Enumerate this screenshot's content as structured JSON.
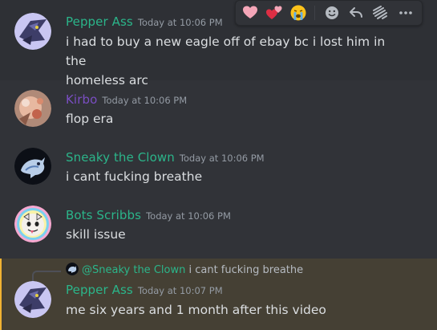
{
  "messages": [
    {
      "username": "Pepper Ass",
      "username_color": "#2bb58a",
      "timestamp": "Today at 10:06 PM",
      "content_line1": "i had to buy a new eagle off of ebay bc i lost him in the",
      "content_line2": "homeless arc"
    },
    {
      "username": "Kirbo",
      "username_color": "#7a4ec2",
      "timestamp": "Today at 10:06 PM",
      "content": "flop era"
    },
    {
      "username": "Sneaky the Clown",
      "username_color": "#2bb58a",
      "timestamp": "Today at 10:06 PM",
      "content": "i cant fucking breathe"
    },
    {
      "username": "Bots Scribbs",
      "username_color": "#2bb58a",
      "timestamp": "Today at 10:06 PM",
      "content": "skill issue"
    },
    {
      "reply_to": {
        "mention": "@Sneaky the Clown",
        "text": "i cant fucking breathe"
      },
      "username": "Pepper Ass",
      "username_color": "#2bb58a",
      "timestamp": "Today at 10:07 PM",
      "content": "me six years and 1 month after this video"
    }
  ],
  "toolbar": {
    "reactions": [
      "heart-emoji",
      "two-hearts-emoji",
      "crying-emoji"
    ],
    "actions": [
      "add-reaction-icon",
      "reply-icon",
      "create-thread-icon",
      "more-icon"
    ]
  },
  "colors": {
    "background": "#313338",
    "hover_background": "#2e3035",
    "mention_background": "#454034",
    "mention_bar": "#f0b232",
    "text": "#dbdee1",
    "timestamp": "#949ba4"
  }
}
